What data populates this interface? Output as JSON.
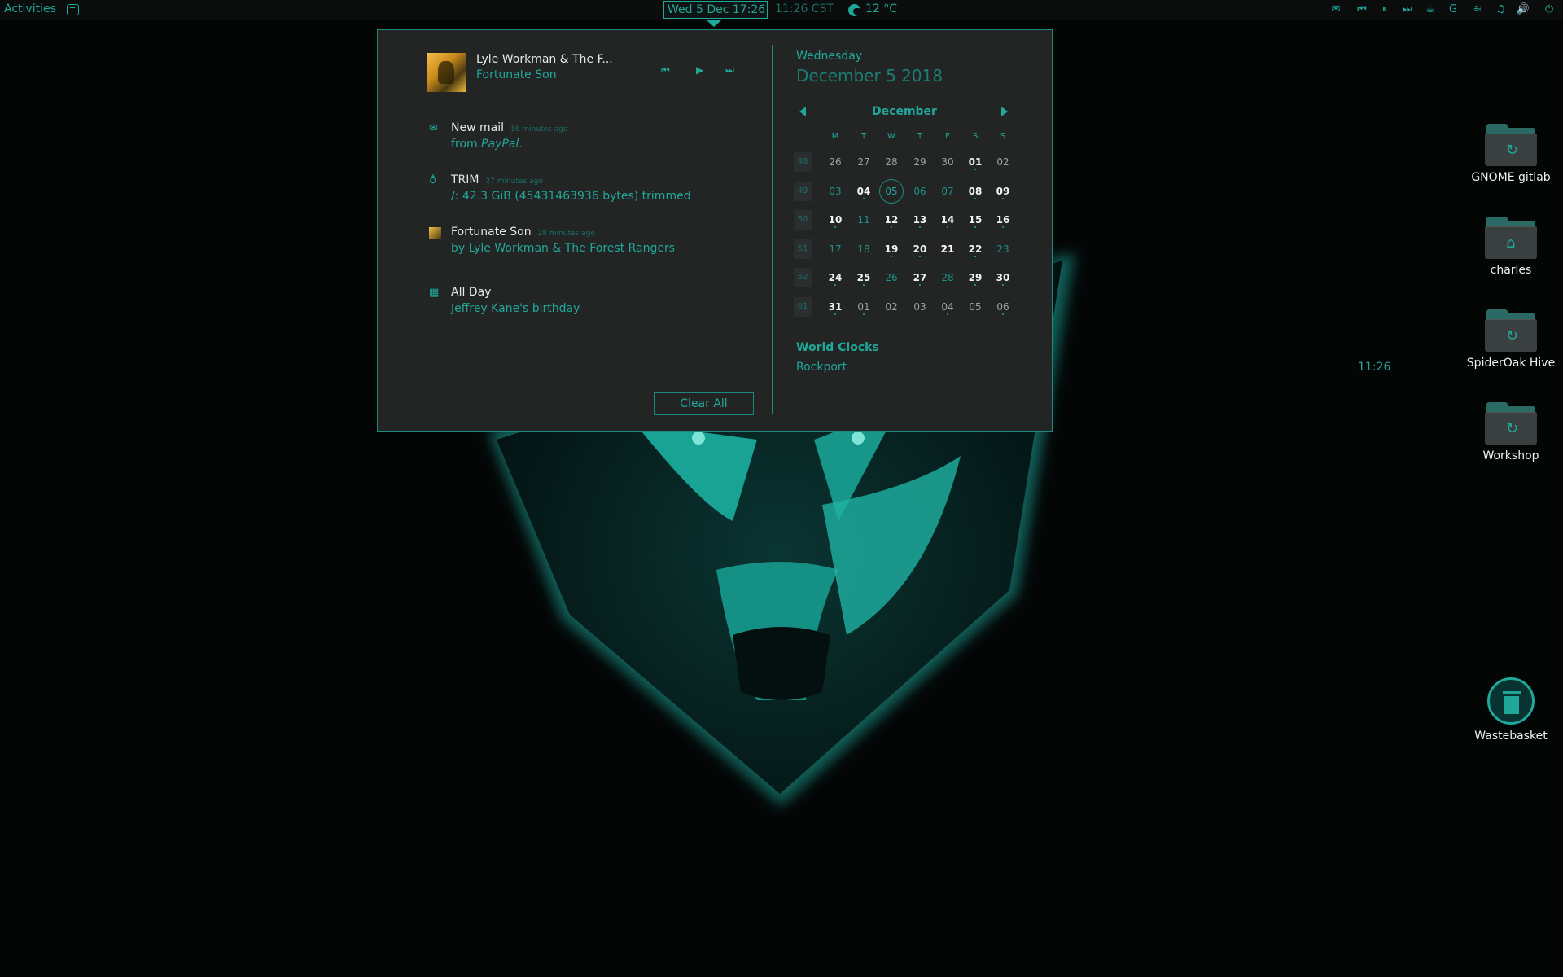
{
  "topbar": {
    "activities": "Activities",
    "clock": "Wed 5 Dec  17:26",
    "world_time": "11:26 CST",
    "temperature": "12 °C",
    "tray_icons": [
      "mail-icon",
      "skip-back-icon",
      "pause-icon",
      "skip-forward-icon",
      "coffee-cup-icon",
      "g-logo-icon",
      "wifi-icon",
      "notification-bell-icon",
      "volume-icon",
      "power-icon"
    ]
  },
  "media": {
    "artist": "Lyle Workman & The F...",
    "title": "Fortunate Son"
  },
  "notifications": [
    {
      "icon": "mail-icon",
      "title": "New mail",
      "time": "16 minutes ago",
      "body_prefix": "from ",
      "body_em": "PayPal",
      "body_suffix": "."
    },
    {
      "icon": "lightbulb-icon",
      "title": "TRIM",
      "time": "27 minutes ago",
      "body": "/: 42.3 GiB (45431463936 bytes) trimmed"
    },
    {
      "icon": "album-art-icon",
      "title": "Fortunate Son",
      "time": "28 minutes ago",
      "body": "by Lyle Workman & The Forest Rangers"
    },
    {
      "icon": "calendar-icon",
      "title": "All Day",
      "time": "",
      "body": "Jeffrey Kane's birthday"
    }
  ],
  "clear_all": "Clear All",
  "calendar": {
    "weekday": "Wednesday",
    "date": "December  5 2018",
    "month": "December",
    "day_headers": [
      "M",
      "T",
      "W",
      "T",
      "F",
      "S",
      "S"
    ],
    "weeks": [
      {
        "num": "48",
        "days": [
          [
            "26",
            "other",
            0
          ],
          [
            "27",
            "other",
            0
          ],
          [
            "28",
            "other",
            0
          ],
          [
            "29",
            "other",
            0
          ],
          [
            "30",
            "other",
            0
          ],
          [
            "01",
            "bold",
            1
          ],
          [
            "02",
            "other",
            0
          ]
        ]
      },
      {
        "num": "49",
        "days": [
          [
            "03",
            "plain",
            0
          ],
          [
            "04",
            "bold",
            1
          ],
          [
            "05",
            "today",
            0
          ],
          [
            "06",
            "plain",
            0
          ],
          [
            "07",
            "plain",
            0
          ],
          [
            "08",
            "bold",
            1
          ],
          [
            "09",
            "bold",
            1
          ]
        ]
      },
      {
        "num": "50",
        "days": [
          [
            "10",
            "bold",
            1
          ],
          [
            "11",
            "plain",
            0
          ],
          [
            "12",
            "bold",
            1
          ],
          [
            "13",
            "bold",
            1
          ],
          [
            "14",
            "bold",
            1
          ],
          [
            "15",
            "bold",
            1
          ],
          [
            "16",
            "bold",
            1
          ]
        ]
      },
      {
        "num": "51",
        "days": [
          [
            "17",
            "plain",
            0
          ],
          [
            "18",
            "plain",
            0
          ],
          [
            "19",
            "bold",
            1
          ],
          [
            "20",
            "bold",
            1
          ],
          [
            "21",
            "selected",
            0
          ],
          [
            "22",
            "bold",
            1
          ],
          [
            "23",
            "plain",
            0
          ]
        ]
      },
      {
        "num": "52",
        "days": [
          [
            "24",
            "bold",
            1
          ],
          [
            "25",
            "bold",
            1
          ],
          [
            "26",
            "plain",
            0
          ],
          [
            "27",
            "bold",
            1
          ],
          [
            "28",
            "plain",
            0
          ],
          [
            "29",
            "bold",
            1
          ],
          [
            "30",
            "bold",
            1
          ]
        ]
      },
      {
        "num": "01",
        "days": [
          [
            "31",
            "bold",
            1
          ],
          [
            "01",
            "other",
            1
          ],
          [
            "02",
            "other",
            0
          ],
          [
            "03",
            "other",
            0
          ],
          [
            "04",
            "other",
            1
          ],
          [
            "05",
            "other",
            0
          ],
          [
            "06",
            "other",
            1
          ]
        ]
      }
    ]
  },
  "world_clocks": {
    "title": "World Clocks",
    "city": "Rockport",
    "time": "11:26"
  },
  "desktop": [
    {
      "label": "GNOME gitlab",
      "icon": "folder-icon",
      "badge": "↻"
    },
    {
      "label": "charles",
      "icon": "home-folder-icon",
      "badge": "⌂"
    },
    {
      "label": "SpiderOak Hive",
      "icon": "folder-icon",
      "badge": "↻"
    },
    {
      "label": "Workshop",
      "icon": "folder-icon",
      "badge": "↻"
    }
  ],
  "trash": {
    "label": "Wastebasket"
  },
  "colors": {
    "accent": "#1fa89a",
    "background": "#040606",
    "panel": "#232525"
  }
}
